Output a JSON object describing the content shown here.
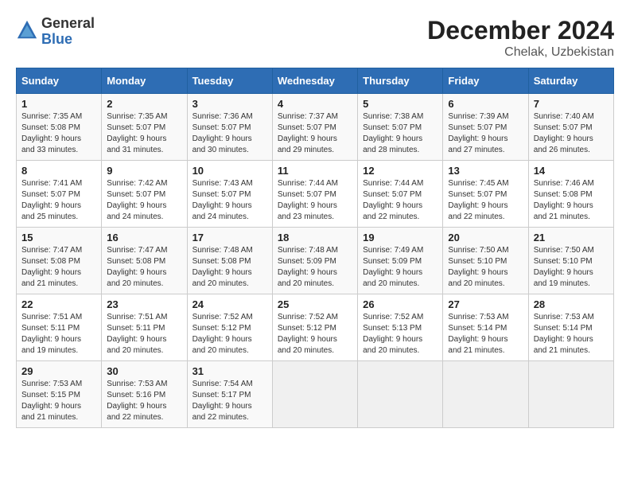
{
  "header": {
    "logo_general": "General",
    "logo_blue": "Blue",
    "main_title": "December 2024",
    "subtitle": "Chelak, Uzbekistan"
  },
  "calendar": {
    "days_of_week": [
      "Sunday",
      "Monday",
      "Tuesday",
      "Wednesday",
      "Thursday",
      "Friday",
      "Saturday"
    ],
    "weeks": [
      [
        null,
        null,
        null,
        null,
        null,
        null,
        null
      ]
    ]
  },
  "cells": [
    {
      "day": "1",
      "sunrise": "7:35 AM",
      "sunset": "5:08 PM",
      "daylight_h": "9",
      "daylight_m": "33"
    },
    {
      "day": "2",
      "sunrise": "7:35 AM",
      "sunset": "5:07 PM",
      "daylight_h": "9",
      "daylight_m": "31"
    },
    {
      "day": "3",
      "sunrise": "7:36 AM",
      "sunset": "5:07 PM",
      "daylight_h": "9",
      "daylight_m": "30"
    },
    {
      "day": "4",
      "sunrise": "7:37 AM",
      "sunset": "5:07 PM",
      "daylight_h": "9",
      "daylight_m": "29"
    },
    {
      "day": "5",
      "sunrise": "7:38 AM",
      "sunset": "5:07 PM",
      "daylight_h": "9",
      "daylight_m": "28"
    },
    {
      "day": "6",
      "sunrise": "7:39 AM",
      "sunset": "5:07 PM",
      "daylight_h": "9",
      "daylight_m": "27"
    },
    {
      "day": "7",
      "sunrise": "7:40 AM",
      "sunset": "5:07 PM",
      "daylight_h": "9",
      "daylight_m": "26"
    },
    {
      "day": "8",
      "sunrise": "7:41 AM",
      "sunset": "5:07 PM",
      "daylight_h": "9",
      "daylight_m": "25"
    },
    {
      "day": "9",
      "sunrise": "7:42 AM",
      "sunset": "5:07 PM",
      "daylight_h": "9",
      "daylight_m": "24"
    },
    {
      "day": "10",
      "sunrise": "7:43 AM",
      "sunset": "5:07 PM",
      "daylight_h": "9",
      "daylight_m": "24"
    },
    {
      "day": "11",
      "sunrise": "7:44 AM",
      "sunset": "5:07 PM",
      "daylight_h": "9",
      "daylight_m": "23"
    },
    {
      "day": "12",
      "sunrise": "7:44 AM",
      "sunset": "5:07 PM",
      "daylight_h": "9",
      "daylight_m": "22"
    },
    {
      "day": "13",
      "sunrise": "7:45 AM",
      "sunset": "5:07 PM",
      "daylight_h": "9",
      "daylight_m": "22"
    },
    {
      "day": "14",
      "sunrise": "7:46 AM",
      "sunset": "5:08 PM",
      "daylight_h": "9",
      "daylight_m": "21"
    },
    {
      "day": "15",
      "sunrise": "7:47 AM",
      "sunset": "5:08 PM",
      "daylight_h": "9",
      "daylight_m": "21"
    },
    {
      "day": "16",
      "sunrise": "7:47 AM",
      "sunset": "5:08 PM",
      "daylight_h": "9",
      "daylight_m": "20"
    },
    {
      "day": "17",
      "sunrise": "7:48 AM",
      "sunset": "5:08 PM",
      "daylight_h": "9",
      "daylight_m": "20"
    },
    {
      "day": "18",
      "sunrise": "7:48 AM",
      "sunset": "5:09 PM",
      "daylight_h": "9",
      "daylight_m": "20"
    },
    {
      "day": "19",
      "sunrise": "7:49 AM",
      "sunset": "5:09 PM",
      "daylight_h": "9",
      "daylight_m": "20"
    },
    {
      "day": "20",
      "sunrise": "7:50 AM",
      "sunset": "5:10 PM",
      "daylight_h": "9",
      "daylight_m": "20"
    },
    {
      "day": "21",
      "sunrise": "7:50 AM",
      "sunset": "5:10 PM",
      "daylight_h": "9",
      "daylight_m": "19"
    },
    {
      "day": "22",
      "sunrise": "7:51 AM",
      "sunset": "5:11 PM",
      "daylight_h": "9",
      "daylight_m": "19"
    },
    {
      "day": "23",
      "sunrise": "7:51 AM",
      "sunset": "5:11 PM",
      "daylight_h": "9",
      "daylight_m": "20"
    },
    {
      "day": "24",
      "sunrise": "7:52 AM",
      "sunset": "5:12 PM",
      "daylight_h": "9",
      "daylight_m": "20"
    },
    {
      "day": "25",
      "sunrise": "7:52 AM",
      "sunset": "5:12 PM",
      "daylight_h": "9",
      "daylight_m": "20"
    },
    {
      "day": "26",
      "sunrise": "7:52 AM",
      "sunset": "5:13 PM",
      "daylight_h": "9",
      "daylight_m": "20"
    },
    {
      "day": "27",
      "sunrise": "7:53 AM",
      "sunset": "5:14 PM",
      "daylight_h": "9",
      "daylight_m": "21"
    },
    {
      "day": "28",
      "sunrise": "7:53 AM",
      "sunset": "5:14 PM",
      "daylight_h": "9",
      "daylight_m": "21"
    },
    {
      "day": "29",
      "sunrise": "7:53 AM",
      "sunset": "5:15 PM",
      "daylight_h": "9",
      "daylight_m": "21"
    },
    {
      "day": "30",
      "sunrise": "7:53 AM",
      "sunset": "5:16 PM",
      "daylight_h": "9",
      "daylight_m": "22"
    },
    {
      "day": "31",
      "sunrise": "7:54 AM",
      "sunset": "5:17 PM",
      "daylight_h": "9",
      "daylight_m": "22"
    }
  ],
  "labels": {
    "sunrise": "Sunrise:",
    "sunset": "Sunset:",
    "daylight": "Daylight:",
    "hours_suffix": "hours",
    "and": "and",
    "minutes_suffix": "minutes."
  }
}
